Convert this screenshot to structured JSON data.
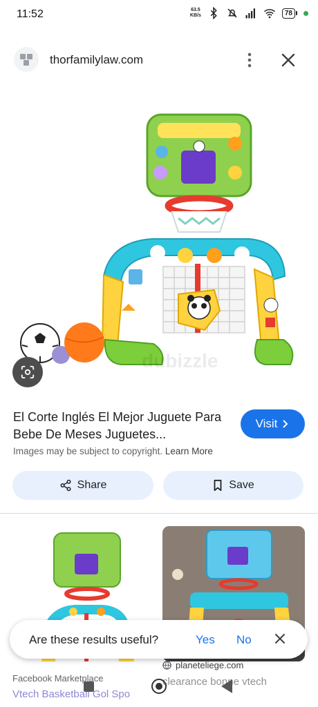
{
  "status_bar": {
    "time": "11:52",
    "net_speed_value": "63.5",
    "net_speed_unit": "KB/s",
    "battery": "78"
  },
  "header": {
    "site": "thorfamilylaw.com"
  },
  "main_image": {
    "watermark": "dubizzle"
  },
  "result": {
    "title": "El Corte Inglés El Mejor Juguete Para Bebe De Meses Juguetes...",
    "visit_label": "Visit",
    "copyright_text": "Images may be subject to copyright.",
    "learn_more": "Learn More",
    "share_label": "Share",
    "save_label": "Save"
  },
  "related": [
    {
      "source": "Facebook Marketplace",
      "title": "Vtech Basketball Gol Spo"
    },
    {
      "source": "planeteliege.com",
      "title": "clearance bonne vtech"
    }
  ],
  "feedback": {
    "question": "Are these results useful?",
    "yes": "Yes",
    "no": "No"
  },
  "colors": {
    "accent": "#1a73e8",
    "chip_bg": "#e8f0fe"
  }
}
